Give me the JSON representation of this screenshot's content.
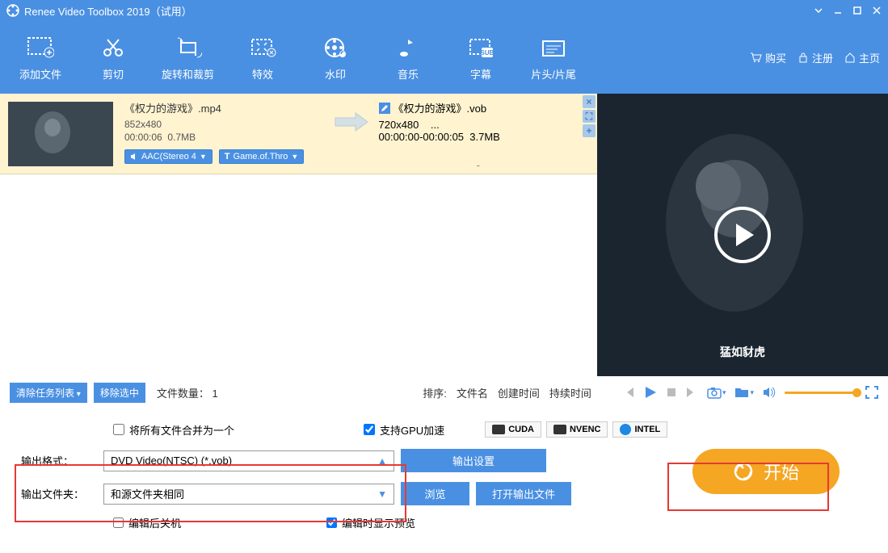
{
  "titlebar": {
    "app_name": "Renee Video Toolbox 2019",
    "trial": "（试用）"
  },
  "toolbar": {
    "items": [
      "添加文件",
      "剪切",
      "旋转和裁剪",
      "特效",
      "水印",
      "音乐",
      "字幕",
      "片头/片尾"
    ],
    "links": {
      "buy": "购买",
      "register": "注册",
      "home": "主页"
    }
  },
  "task": {
    "src": {
      "name": "《权力的游戏》.mp4",
      "res": "852x480",
      "dur": "00:00:06",
      "size": "0.7MB",
      "audio_badge": "AAC(Stereo 4",
      "subtitle_badge": "Game.of.Thro"
    },
    "out": {
      "name": "《权力的游戏》.vob",
      "res": "720x480",
      "res_extra": "...",
      "dur": "00:00:00-00:00:05",
      "size": "3.7MB",
      "dash": "-"
    }
  },
  "preview": {
    "subtitle": "猛如豺虎"
  },
  "ctrlbar": {
    "clear_btn": "清除任务列表",
    "remove_btn": "移除选中",
    "file_count_label": "文件数量：",
    "file_count": "1",
    "sort_label": "排序:",
    "sort_options": [
      "文件名",
      "创建时间",
      "持续时间"
    ]
  },
  "settings": {
    "merge_all": "将所有文件合并为一个",
    "gpu_accel": "支持GPU加速",
    "gpu_badges": [
      "CUDA",
      "NVENC",
      "INTEL"
    ],
    "output_format_label": "输出格式：",
    "output_format_value": "DVD Video(NTSC) (*.vob)",
    "output_settings_btn": "输出设置",
    "output_folder_label": "输出文件夹：",
    "output_folder_value": "和源文件夹相同",
    "browse_btn": "浏览",
    "open_output_btn": "打开输出文件",
    "shutdown_after": "编辑后关机",
    "preview_while": "编辑时显示预览",
    "start_btn": "开始"
  }
}
